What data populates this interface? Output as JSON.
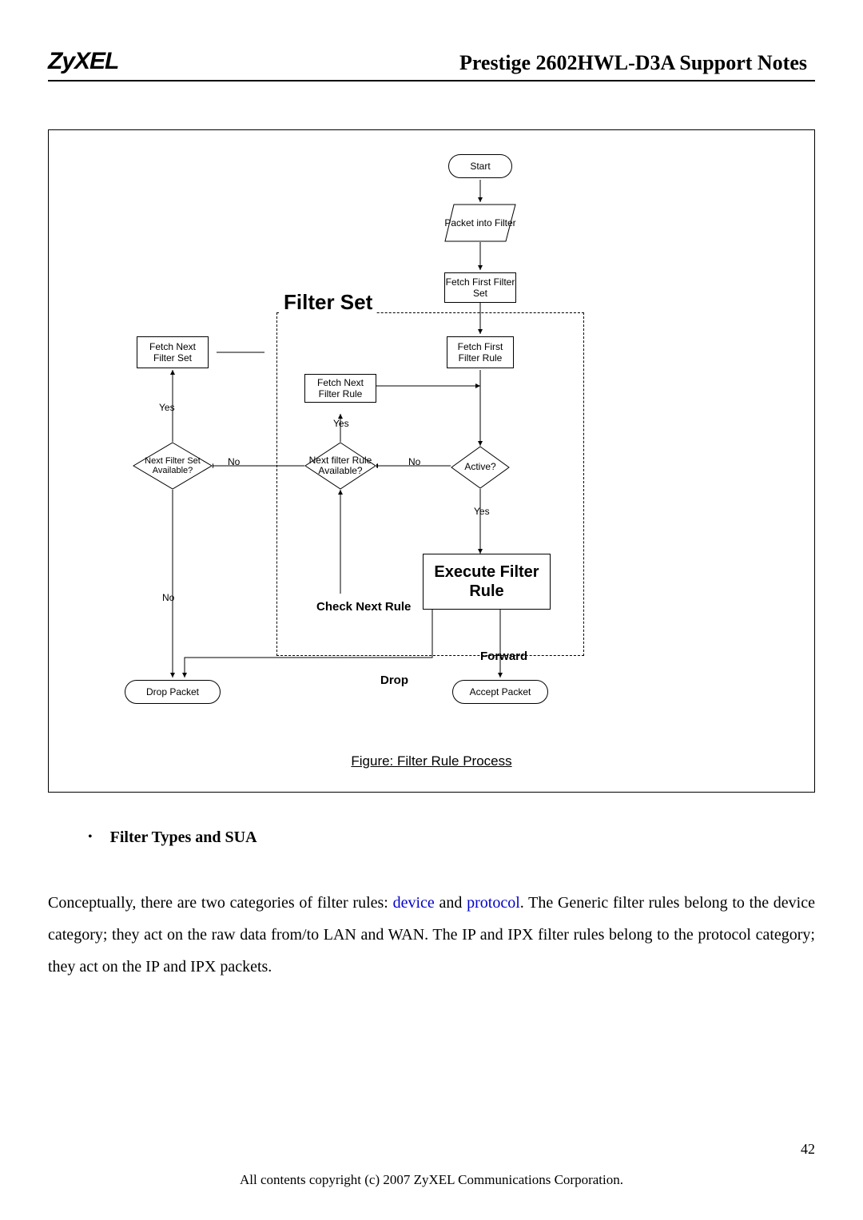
{
  "header": {
    "logo": "ZyXEL",
    "title": "Prestige 2602HWL-D3A Support Notes"
  },
  "flowchart": {
    "start": "Start",
    "packet_into_filter": "Packet into Filter",
    "fetch_first_set": "Fetch First Filter Set",
    "filter_set_heading": "Filter Set",
    "fetch_first_rule": "Fetch First Filter Rule",
    "fetch_next_set": "Fetch Next Filter Set",
    "fetch_next_rule": "Fetch Next Filter Rule",
    "next_set_available": "Next Filter Set Available?",
    "next_rule_available": "Next filter Rule Available?",
    "active": "Active?",
    "execute_rule": "Execute Filter Rule",
    "check_next_rule": "Check Next Rule",
    "drop_packet": "Drop Packet",
    "accept_packet": "Accept Packet",
    "forward": "Forward",
    "drop": "Drop",
    "yes": "Yes",
    "no": "No",
    "caption": "Figure: Filter Rule Process"
  },
  "section": {
    "bullet_title": "Filter Types and SUA",
    "paragraph_pre": "Conceptually, there are two categories of filter rules: ",
    "device": "device",
    "and": " and ",
    "protocol": "protocol",
    "paragraph_post": ". The Generic filter rules belong to the device category; they act on the raw data from/to LAN and WAN. The IP and IPX filter rules belong to the protocol category; they act on the IP and IPX packets."
  },
  "footer": {
    "page": "42",
    "copyright": "All contents copyright (c) 2007 ZyXEL Communications Corporation."
  }
}
